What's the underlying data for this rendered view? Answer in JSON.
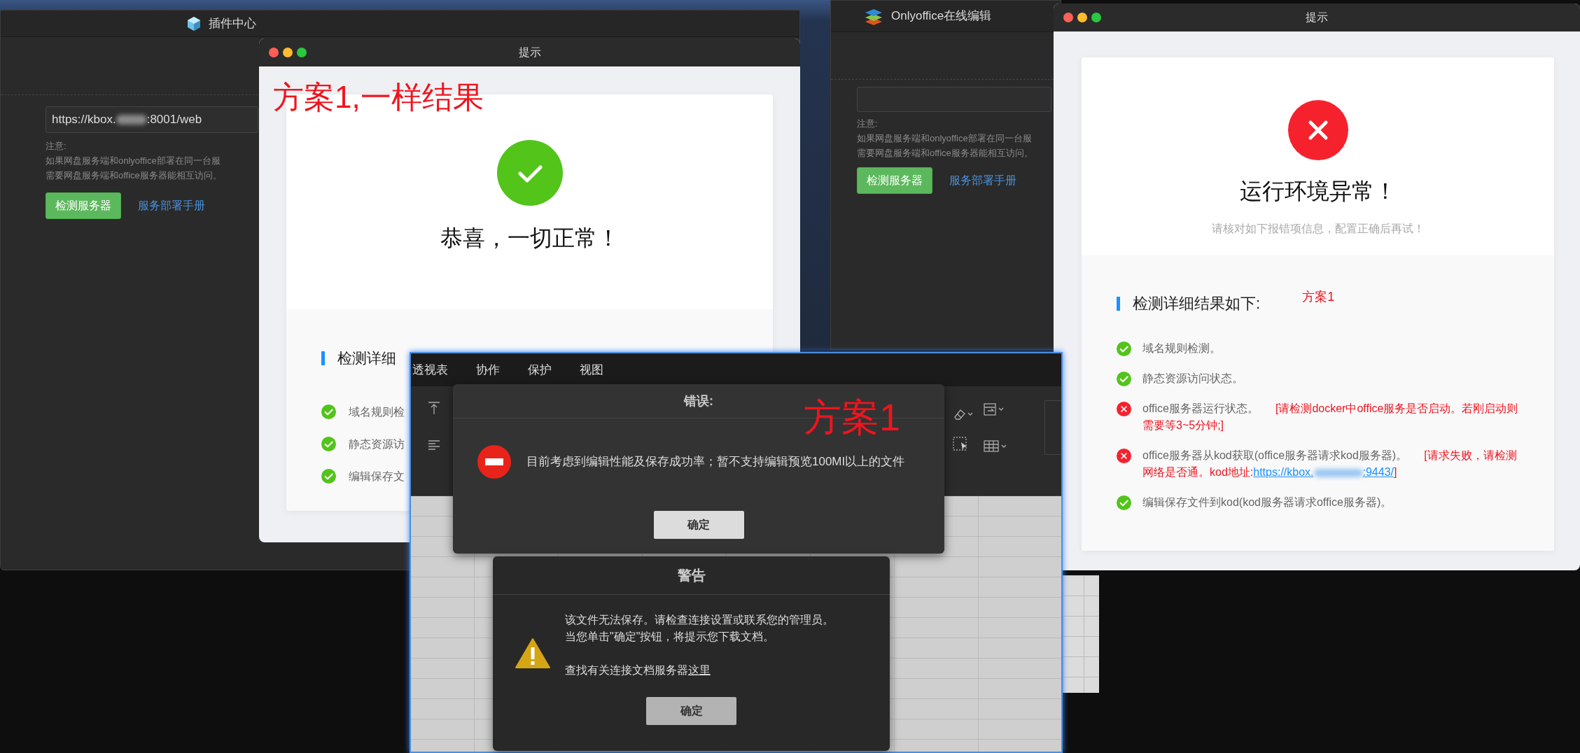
{
  "plugin_window": {
    "title": "插件中心",
    "server_url": [
      {
        "kind": "text",
        "text": "https://kbox."
      },
      {
        "kind": "redaction"
      },
      {
        "kind": "text",
        "text": ":8001/web"
      }
    ],
    "note_label": "注意:",
    "note_lines": [
      "如果网盘服务端和onlyoffice部署在同一台服",
      "需要网盘服务端和office服务器能相互访问。"
    ],
    "check_button": "检测服务器",
    "manual_link": "服务部署手册"
  },
  "success_dialog": {
    "title": "提示",
    "annotation": "方案1,一样结果",
    "headline": "恭喜，一切正常！",
    "details_title": "检测详细",
    "results": [
      {
        "label": "域名规则检",
        "passed": true
      },
      {
        "label": "静态资源访",
        "passed": true
      },
      {
        "label": "编辑保存文",
        "passed": true
      }
    ]
  },
  "onlyoffice_window": {
    "title": "Onlyoffice在线编辑",
    "note_label": "注意:",
    "note_lines": [
      "如果网盘服务端和onlyoffice部署在同一台服",
      "需要网盘服务端和office服务器能相互访问。"
    ],
    "check_button": "检测服务器",
    "manual_link": "服务部署手册"
  },
  "error_dialog": {
    "title": "提示",
    "headline": "运行环境异常！",
    "subtitle": "请核对如下报错项信息，配置正确后再试！",
    "details_title": "检测详细结果如下:",
    "annotation": "方案1",
    "results": [
      {
        "label": "域名规则检测。",
        "passed": true
      },
      {
        "label": "静态资源访问状态。",
        "passed": true
      },
      {
        "label": "office服务器运行状态。",
        "passed": false,
        "note": [
          {
            "kind": "text",
            "text": "[请检测docker中office服务是否启动。若刚启动则需要等3~5分钟;]"
          }
        ]
      },
      {
        "label": "office服务器从kod获取(office服务器请求kod服务器)。",
        "passed": false,
        "note": [
          {
            "kind": "text",
            "text": "[请求失败，请检测网络是否通。kod地址:"
          },
          {
            "kind": "link",
            "text": "https://kbox."
          },
          {
            "kind": "redaction"
          },
          {
            "kind": "link",
            "text": ":9443/"
          },
          {
            "kind": "text",
            "text": "]"
          }
        ]
      },
      {
        "label": "编辑保存文件到kod(kod服务器请求office服务器)。",
        "passed": true
      }
    ]
  },
  "spreadsheet": {
    "menu": [
      {
        "label": "透视表"
      },
      {
        "label": "协作"
      },
      {
        "label": "保护"
      },
      {
        "label": "视图"
      }
    ]
  },
  "error_alert": {
    "title": "错误:",
    "message": "目前考虑到编辑性能及保存成功率；暂不支持编辑预览100MI以上的文件",
    "button": "确定",
    "annotation": "方案1"
  },
  "warning_alert": {
    "title": "警告",
    "message_lines": [
      "该文件无法保存。请检查连接设置或联系您的管理员。",
      "当您单击\"确定\"按钮，将提示您下载文档。"
    ],
    "help": [
      {
        "kind": "text",
        "text": "查找有关连接文档服务器"
      },
      {
        "kind": "link",
        "text": "这里"
      }
    ],
    "button": "确定"
  }
}
